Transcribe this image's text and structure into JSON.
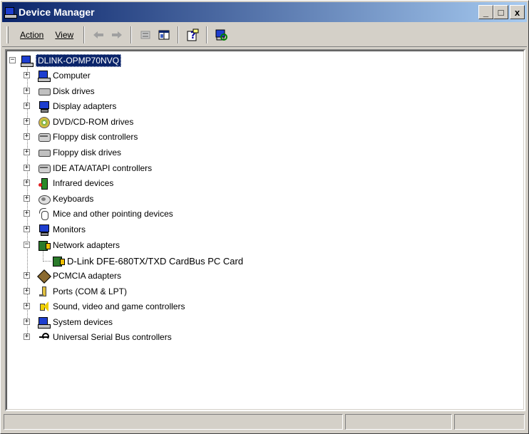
{
  "window": {
    "title": "Device Manager",
    "buttons": {
      "minimize": "_",
      "maximize": "□",
      "close": "x"
    }
  },
  "menu": {
    "action_label": "Action",
    "view_label": "View"
  },
  "toolbar": {
    "tools": [
      "back-icon",
      "forward-icon",
      "properties-icon",
      "show-hide-tree-icon",
      "help-icon",
      "scan-hardware-icon"
    ]
  },
  "tree": {
    "root": {
      "label": "DLINK-OPMP70NVQ",
      "icon": "computer-icon"
    },
    "categories": [
      {
        "label": "Computer",
        "icon": "monitor-icon",
        "expanded": false
      },
      {
        "label": "Disk drives",
        "icon": "disk-icon",
        "expanded": false
      },
      {
        "label": "Display adapters",
        "icon": "monitor-icon",
        "expanded": false
      },
      {
        "label": "DVD/CD-ROM drives",
        "icon": "cd-icon",
        "expanded": false
      },
      {
        "label": "Floppy disk controllers",
        "icon": "controller-icon",
        "expanded": false
      },
      {
        "label": "Floppy disk drives",
        "icon": "disk-icon",
        "expanded": false
      },
      {
        "label": "IDE ATA/ATAPI controllers",
        "icon": "controller-icon",
        "expanded": false
      },
      {
        "label": "Infrared devices",
        "icon": "infrared-icon",
        "expanded": false
      },
      {
        "label": "Keyboards",
        "icon": "keyboard-icon",
        "expanded": false
      },
      {
        "label": "Mice and other pointing devices",
        "icon": "mouse-icon",
        "expanded": false
      },
      {
        "label": "Monitors",
        "icon": "monitor-icon",
        "expanded": false
      },
      {
        "label": "Network adapters",
        "icon": "network-icon",
        "expanded": true,
        "children": [
          "D-Link DFE-680TX/TXD CardBus PC Card"
        ]
      },
      {
        "label": "PCMCIA adapters",
        "icon": "pcmcia-icon",
        "expanded": false
      },
      {
        "label": "Ports (COM & LPT)",
        "icon": "port-icon",
        "expanded": false
      },
      {
        "label": "Sound, video and game controllers",
        "icon": "sound-icon",
        "expanded": false
      },
      {
        "label": "System devices",
        "icon": "monitor-icon",
        "expanded": false
      },
      {
        "label": "Universal Serial Bus controllers",
        "icon": "usb-icon",
        "expanded": false
      }
    ]
  },
  "colors": {
    "title_gradient_start": "#0a246a",
    "title_gradient_end": "#a6caf0",
    "selection": "#0a246a",
    "window_bg": "#d4d0c8"
  }
}
